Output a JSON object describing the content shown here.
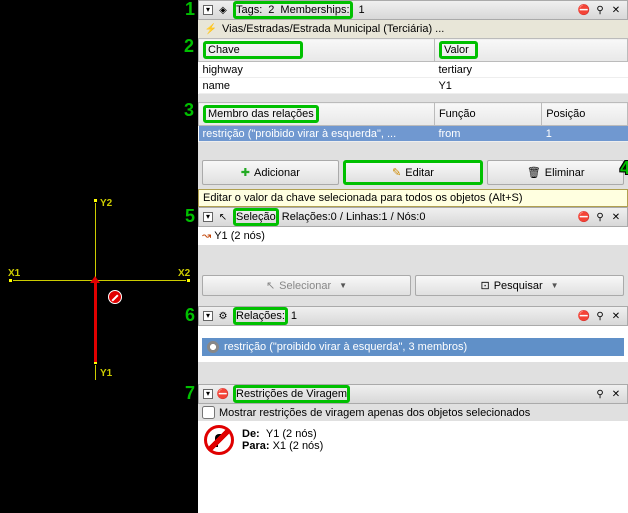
{
  "callouts": {
    "n1": "1",
    "n2": "2",
    "n3": "3",
    "n4": "4",
    "n5": "5",
    "n6": "6",
    "n7": "7"
  },
  "map": {
    "x1": "X1",
    "x2": "X2",
    "y1": "Y1",
    "y2": "Y2"
  },
  "tags_panel": {
    "toggle_glyph": "▾",
    "tags_label": "Tags:",
    "tags_count": "2",
    "memberships_label": "Memberships:",
    "memberships_count": "1",
    "preset_path": "Vias/Estradas/Estrada Municipal (Terciária) ...",
    "col_key": "Chave",
    "col_val": "Valor",
    "rows": [
      {
        "k": "highway",
        "v": "tertiary"
      },
      {
        "k": "name",
        "v": "Y1"
      }
    ]
  },
  "members_panel": {
    "col_member": "Membro das relações",
    "col_role": "Função",
    "col_pos": "Posição",
    "row": {
      "member": "restrição (\"proibido virar à esquerda\", ...",
      "role": "from",
      "pos": "1"
    }
  },
  "tag_buttons": {
    "add": "Adicionar",
    "edit": "Editar",
    "delete": "Eliminar",
    "tooltip": "Editar o valor da chave selecionada para todos os objetos (Alt+S)"
  },
  "selection_panel": {
    "toggle_glyph": "▾",
    "label": "Seleção",
    "summary": "Relações:0 / Linhas:1 / Nós:0",
    "item": "Y1 (2 nós)",
    "btn_select": "Selecionar",
    "btn_search": "Pesquisar"
  },
  "relations_panel": {
    "toggle_glyph": "▾",
    "label": "Relações:",
    "count": "1",
    "item": "restrição (\"proibido virar à esquerda\", 3 membros)"
  },
  "restrictions_panel": {
    "toggle_glyph": "▾",
    "label": "Restrições de Viragem",
    "checkbox_label": "Mostrar restrições de viragem apenas dos objetos selecionados",
    "from_label": "De:",
    "from_val": "Y1 (2 nós)",
    "to_label": "Para:",
    "to_val": "X1 (2 nós)"
  },
  "icons": {
    "tag": "◈",
    "road": "⚡",
    "way": "↝",
    "cursor": "↖",
    "search": "⊡",
    "rel": "⚙",
    "no_entry": "⛔",
    "pin": "⚲",
    "close": "✕",
    "plus": "✚",
    "edit": "✎",
    "trash": "🗑"
  }
}
